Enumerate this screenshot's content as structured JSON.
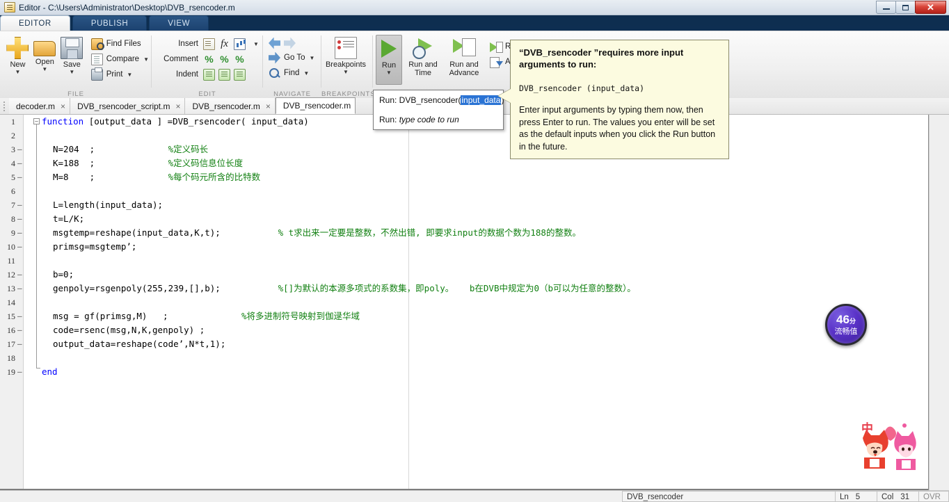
{
  "window": {
    "title": "Editor - C:\\Users\\Administrator\\Desktop\\DVB_rsencoder.m",
    "icon": "matlab-editor-icon",
    "minimize_label": "–",
    "maximize_label": "❐",
    "close_label": "✕"
  },
  "ribbon": {
    "tabs": [
      {
        "label": "EDITOR",
        "active": true
      },
      {
        "label": "PUBLISH",
        "active": false
      },
      {
        "label": "VIEW",
        "active": false
      }
    ],
    "groups": [
      {
        "label": "FILE"
      },
      {
        "label": "EDIT"
      },
      {
        "label": "NAVIGATE"
      },
      {
        "label": "BREAKPOINTS"
      },
      {
        "label": "RUN"
      }
    ],
    "file": {
      "new": "New",
      "open": "Open",
      "save": "Save",
      "find_files": "Find Files",
      "compare": "Compare",
      "print": "Print"
    },
    "edit": {
      "insert": "Insert",
      "comment": "Comment",
      "indent": "Indent"
    },
    "navigate": {
      "go_to": "Go To",
      "find": "Find"
    },
    "breakpoints": {
      "label": "Breakpoints"
    },
    "run": {
      "run": "Run",
      "run_and_time_line1": "Run and",
      "run_and_time_line2": "Time",
      "run_and_advance_line1": "Run and",
      "run_and_advance_line2": "Advance",
      "run_section": "Run S",
      "advance": "Adva"
    },
    "quick_access": [
      {
        "name": "new-script-icon"
      },
      {
        "name": "save-icon"
      },
      {
        "name": "cut-icon"
      },
      {
        "name": "copy-icon"
      },
      {
        "name": "paste-icon"
      },
      {
        "name": "undo-icon"
      },
      {
        "name": "redo-icon"
      },
      {
        "name": "switch-window-icon"
      },
      {
        "name": "help-icon"
      },
      {
        "name": "dropdown-icon"
      },
      {
        "name": "collapse-ribbon-icon"
      }
    ]
  },
  "run_menu": {
    "item1_prefix": "Run: DVB_rsencoder(",
    "item1_highlight": "input_data",
    "item1_suffix": ")",
    "item2_prefix": "Run: ",
    "item2_italic": "type code to run"
  },
  "tooltip": {
    "title": "“DVB_rsencoder ”requires more input arguments to run:",
    "code": "DVB_rsencoder (input_data)",
    "body": "Enter input arguments by typing them now, then press Enter to run. The values you enter will be set as the default inputs when you click the Run button in the future."
  },
  "doc_tabs": [
    {
      "label": "decoder.m",
      "active": false,
      "close": "×"
    },
    {
      "label": "DVB_rsencoder_script.m",
      "active": false,
      "close": "×"
    },
    {
      "label": "DVB_rsencoder.m",
      "active": false,
      "close": "×"
    },
    {
      "label": "DVB_rsencoder.m",
      "active": true,
      "close": "×"
    }
  ],
  "code": {
    "lines": [
      {
        "n": "1",
        "exec": false,
        "indent": 0,
        "parts": [
          {
            "t": "function ",
            "c": "kw"
          },
          {
            "t": "[output_data ] =DVB_rsencoder( input_data)",
            "c": "pln"
          }
        ]
      },
      {
        "n": "2",
        "exec": false,
        "indent": 0,
        "parts": []
      },
      {
        "n": "3",
        "exec": true,
        "indent": 1,
        "parts": [
          {
            "t": "N=204  ;              ",
            "c": "pln"
          },
          {
            "t": "%定义码长",
            "c": "cm"
          }
        ]
      },
      {
        "n": "4",
        "exec": true,
        "indent": 1,
        "parts": [
          {
            "t": "K=188  ;              ",
            "c": "pln"
          },
          {
            "t": "%定义码信息位长度",
            "c": "cm"
          }
        ]
      },
      {
        "n": "5",
        "exec": true,
        "indent": 1,
        "parts": [
          {
            "t": "M=8    ;              ",
            "c": "pln"
          },
          {
            "t": "%每个码元所含的比特数",
            "c": "cm"
          }
        ]
      },
      {
        "n": "6",
        "exec": false,
        "indent": 1,
        "parts": []
      },
      {
        "n": "7",
        "exec": true,
        "indent": 1,
        "parts": [
          {
            "t": "L=length(input_data);",
            "c": "pln"
          }
        ]
      },
      {
        "n": "8",
        "exec": true,
        "indent": 1,
        "parts": [
          {
            "t": "t=L/K;",
            "c": "pln"
          }
        ]
      },
      {
        "n": "9",
        "exec": true,
        "indent": 1,
        "parts": [
          {
            "t": "msgtemp=reshape(input_data,K,t);           ",
            "c": "pln"
          },
          {
            "t": "% t求出来一定要是整数，不然出错, 即要求input的数据个数为188的整数。",
            "c": "cm"
          }
        ]
      },
      {
        "n": "10",
        "exec": true,
        "indent": 1,
        "parts": [
          {
            "t": "primsg=msgtemp’;",
            "c": "pln"
          }
        ]
      },
      {
        "n": "11",
        "exec": false,
        "indent": 1,
        "parts": []
      },
      {
        "n": "12",
        "exec": true,
        "indent": 1,
        "parts": [
          {
            "t": "b=0;",
            "c": "pln"
          }
        ]
      },
      {
        "n": "13",
        "exec": true,
        "indent": 1,
        "parts": [
          {
            "t": "genpoly=rsgenpoly(255,239,[],b);           ",
            "c": "pln"
          },
          {
            "t": "%[]为默认的本源多项式的系数集，即poly。   b在DVB中规定为0（b可以为任意的整数）。",
            "c": "cm"
          }
        ]
      },
      {
        "n": "14",
        "exec": false,
        "indent": 1,
        "parts": []
      },
      {
        "n": "15",
        "exec": true,
        "indent": 1,
        "parts": [
          {
            "t": "msg = gf(primsg,M)   ;              ",
            "c": "pln"
          },
          {
            "t": "%将多进制符号映射到伽逯华域",
            "c": "cm"
          }
        ]
      },
      {
        "n": "16",
        "exec": true,
        "indent": 1,
        "parts": [
          {
            "t": "code=rsenc(msg,N,K,genpoly) ;",
            "c": "pln"
          }
        ]
      },
      {
        "n": "17",
        "exec": true,
        "indent": 1,
        "parts": [
          {
            "t": "output_data=reshape(code’,N*t,1);",
            "c": "pln"
          }
        ]
      },
      {
        "n": "18",
        "exec": false,
        "indent": 1,
        "parts": []
      },
      {
        "n": "19",
        "exec": true,
        "indent": 0,
        "parts": [
          {
            "t": "end",
            "c": "kw"
          }
        ]
      }
    ]
  },
  "badge": {
    "number": "46",
    "unit": "分",
    "label": "流畅值"
  },
  "mascot": {
    "text": "中"
  },
  "status_bar": {
    "function_name": "DVB_rsencoder",
    "ln_key": "Ln",
    "ln_value": "5",
    "col_key": "Col",
    "col_value": "31",
    "mode": "OVR"
  },
  "colors": {
    "keyword": "#0000ff",
    "comment": "#128012",
    "highlight": "#2a73d4",
    "tooltip_bg": "#fcfbe0",
    "ribbon_blue": "#11355c",
    "run_green": "#5aa832"
  }
}
